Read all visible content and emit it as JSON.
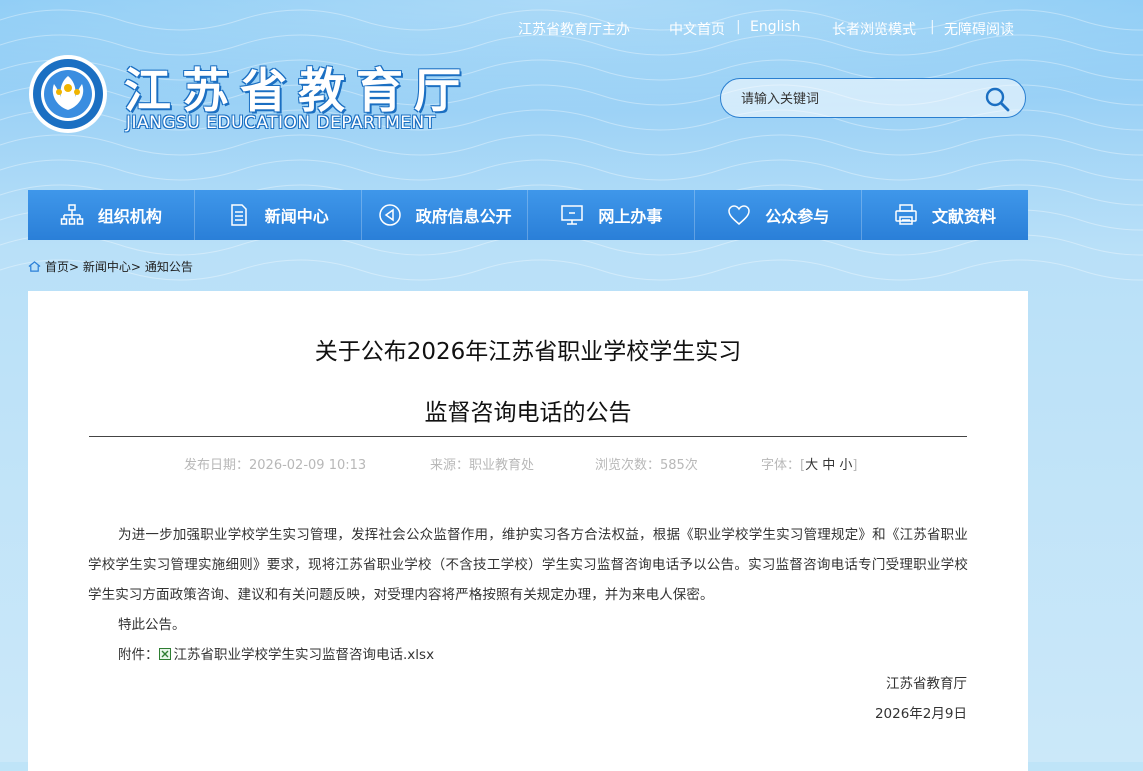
{
  "header": {
    "toplinks": {
      "sponsor": "江苏省教育厅主办",
      "home_cn": "中文首页",
      "english": "English",
      "elderly_mode": "长者浏览模式",
      "accessible_read": "无障碍阅读"
    },
    "logo": {
      "title_cn": "江苏省教育厅",
      "title_en": "JIANGSU EDUCATION DEPARTMENT"
    },
    "search": {
      "placeholder": "请输入关键词"
    }
  },
  "nav": {
    "items": [
      {
        "label": "组织机构",
        "icon": "org-chart-icon"
      },
      {
        "label": "新闻中心",
        "icon": "document-icon"
      },
      {
        "label": "政府信息公开",
        "icon": "megaphone-icon"
      },
      {
        "label": "网上办事",
        "icon": "monitor-icon"
      },
      {
        "label": "公众参与",
        "icon": "heart-icon"
      },
      {
        "label": "文献资料",
        "icon": "printer-icon"
      }
    ]
  },
  "breadcrumb": {
    "home": "首页",
    "news": "新闻中心",
    "current": "通知公告",
    "sep": ">"
  },
  "article": {
    "title_line1": "关于公布2026年江苏省职业学校学生实习",
    "title_line2": "监督咨询电话的公告",
    "meta": {
      "date_label": "发布日期：",
      "date": "2026-02-09 10:13",
      "source_label": "来源：",
      "source": "职业教育处",
      "views_label": "浏览次数：",
      "views": "585次",
      "font_label": "字体：",
      "font_large": "大",
      "font_medium": "中",
      "font_small": "小"
    },
    "paragraph": "为进一步加强职业学校学生实习管理，发挥社会公众监督作用，维护实习各方合法权益，根据《职业学校学生实习管理规定》和《江苏省职业学校学生实习管理实施细则》要求，现将江苏省职业学校（不含技工学校）学生实习监督咨询电话予以公告。实习监督咨询电话专门受理职业学校学生实习方面政策咨询、建议和有关问题反映，对受理内容将严格按照有关规定办理，并为来电人保密。",
    "closing": "特此公告。",
    "attachment_label": "附件：",
    "attachment_file": "江苏省职业学校学生实习监督咨询电话.xlsx",
    "signature": "江苏省教育厅",
    "sign_date": "2026年2月9日"
  },
  "colors": {
    "nav_blue": "#3189e0",
    "brand_blue": "#1b6fc2",
    "meta_gray": "#b8b8b8"
  }
}
